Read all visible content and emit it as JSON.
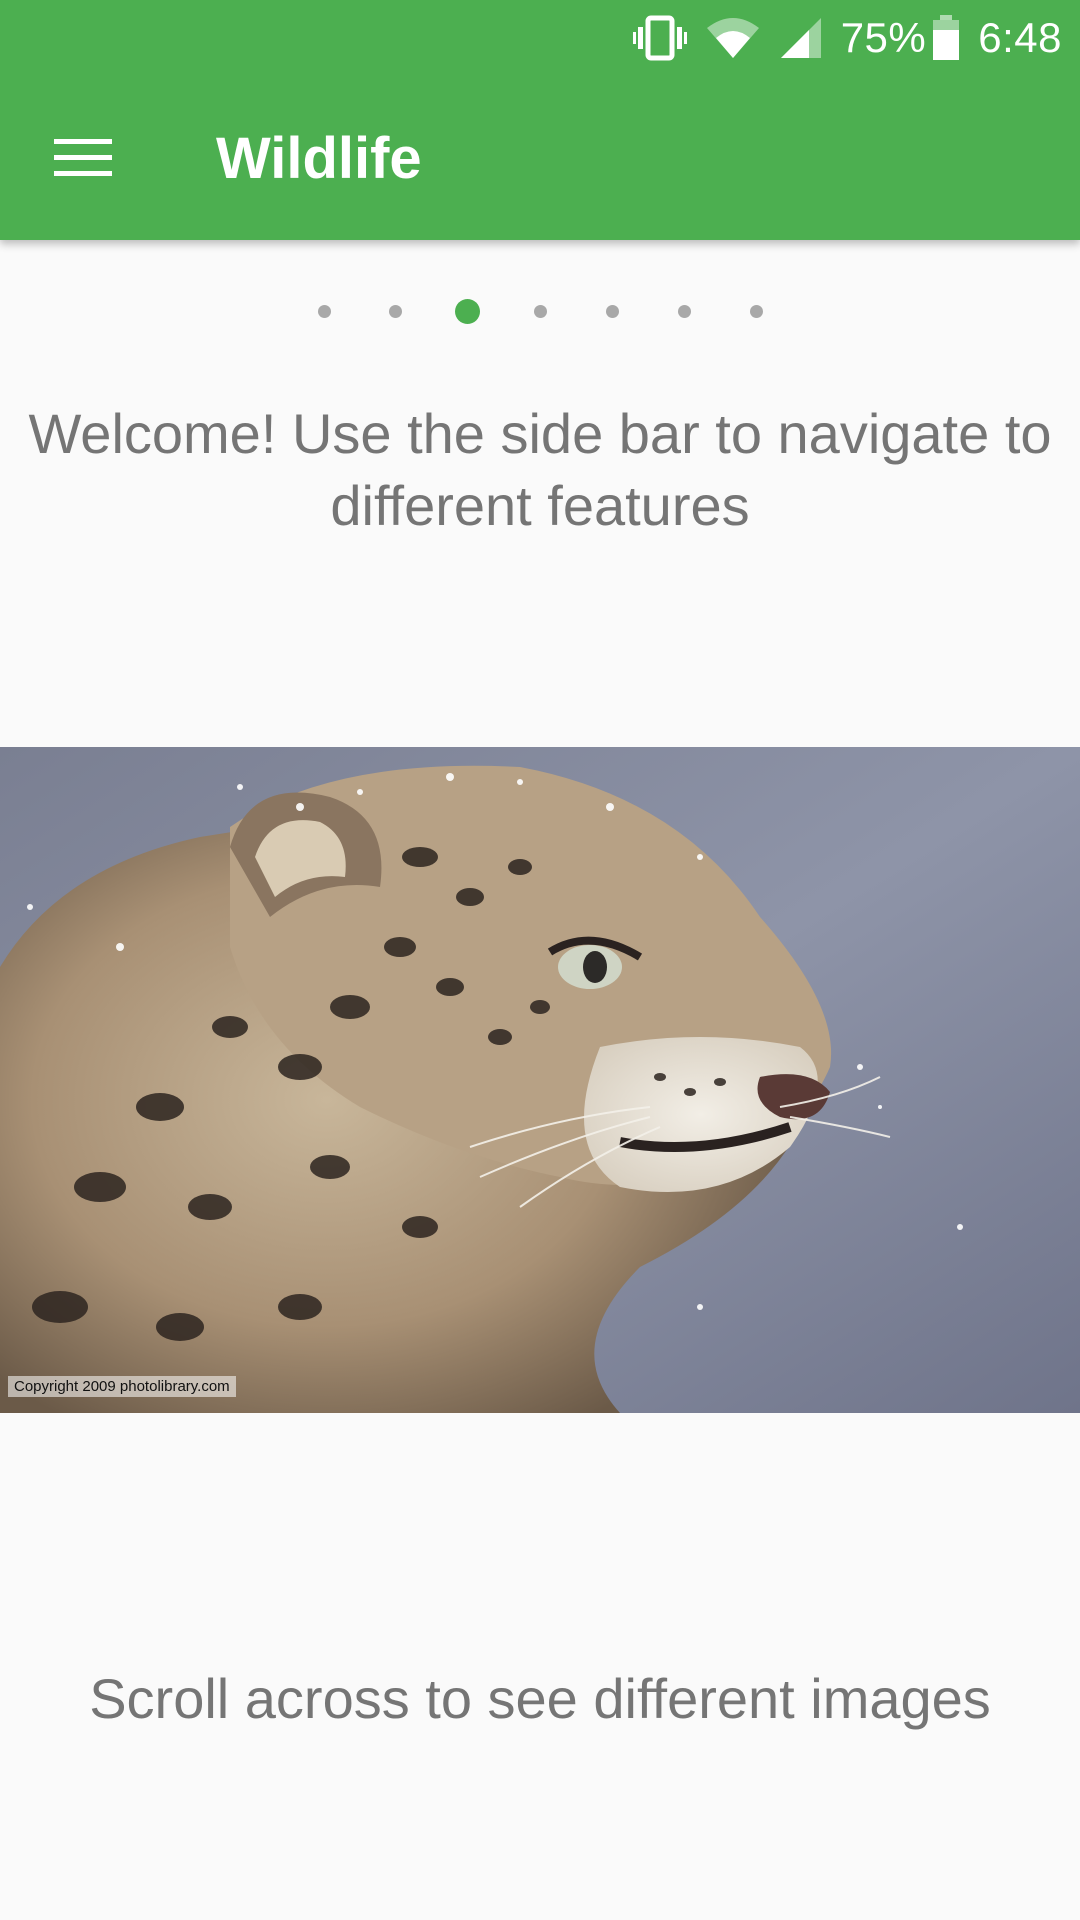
{
  "status_bar": {
    "battery_percent": "75%",
    "time": "6:48",
    "icons": [
      "vibrate-icon",
      "wifi-icon",
      "cell-signal-icon",
      "battery-icon"
    ]
  },
  "toolbar": {
    "title": "Wildlife",
    "menu_icon": "hamburger-menu-icon"
  },
  "pager": {
    "count": 7,
    "active_index": 2
  },
  "welcome_message": "Welcome! Use the side bar to navigate to different features",
  "hero_image": {
    "subject": "snow leopard",
    "credit": "Copyright 2009 photolibrary.com"
  },
  "scroll_hint": "Scroll across to see different images",
  "colors": {
    "primary": "#4caf50",
    "text_secondary": "#757575",
    "background": "#fafafa",
    "dot_inactive": "#a8a8a8"
  }
}
